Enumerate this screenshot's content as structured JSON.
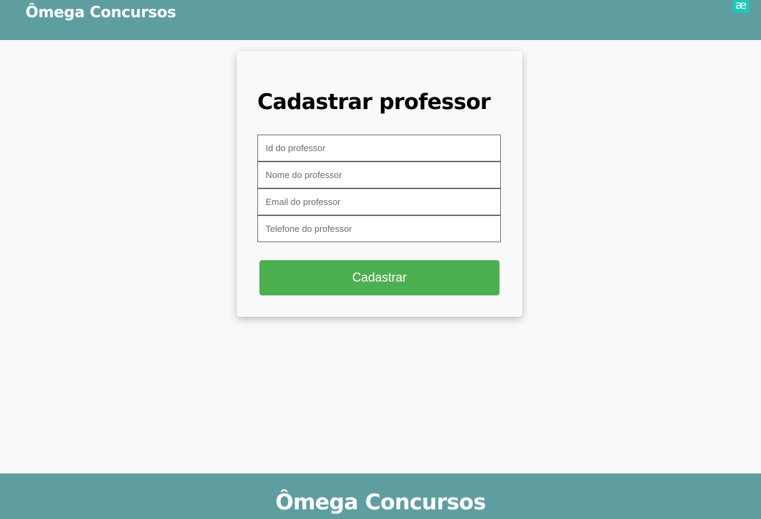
{
  "header": {
    "brand": "Ômega Concursos",
    "extension_icon": "ae-extension-icon",
    "extension_glyph": "æ"
  },
  "form": {
    "title": "Cadastrar professor",
    "fields": [
      {
        "placeholder": "Id do professor",
        "value": ""
      },
      {
        "placeholder": "Nome do professor",
        "value": ""
      },
      {
        "placeholder": "Email do professor",
        "value": ""
      },
      {
        "placeholder": "Telefone do professor",
        "value": ""
      }
    ],
    "submit_label": "Cadastrar"
  },
  "footer": {
    "title": "Ômega Concursos"
  },
  "colors": {
    "header_bg": "#5f9ea0",
    "footer_bg": "#5f9ea0",
    "button_bg": "#4caf50",
    "page_bg": "#f9f9f9"
  }
}
